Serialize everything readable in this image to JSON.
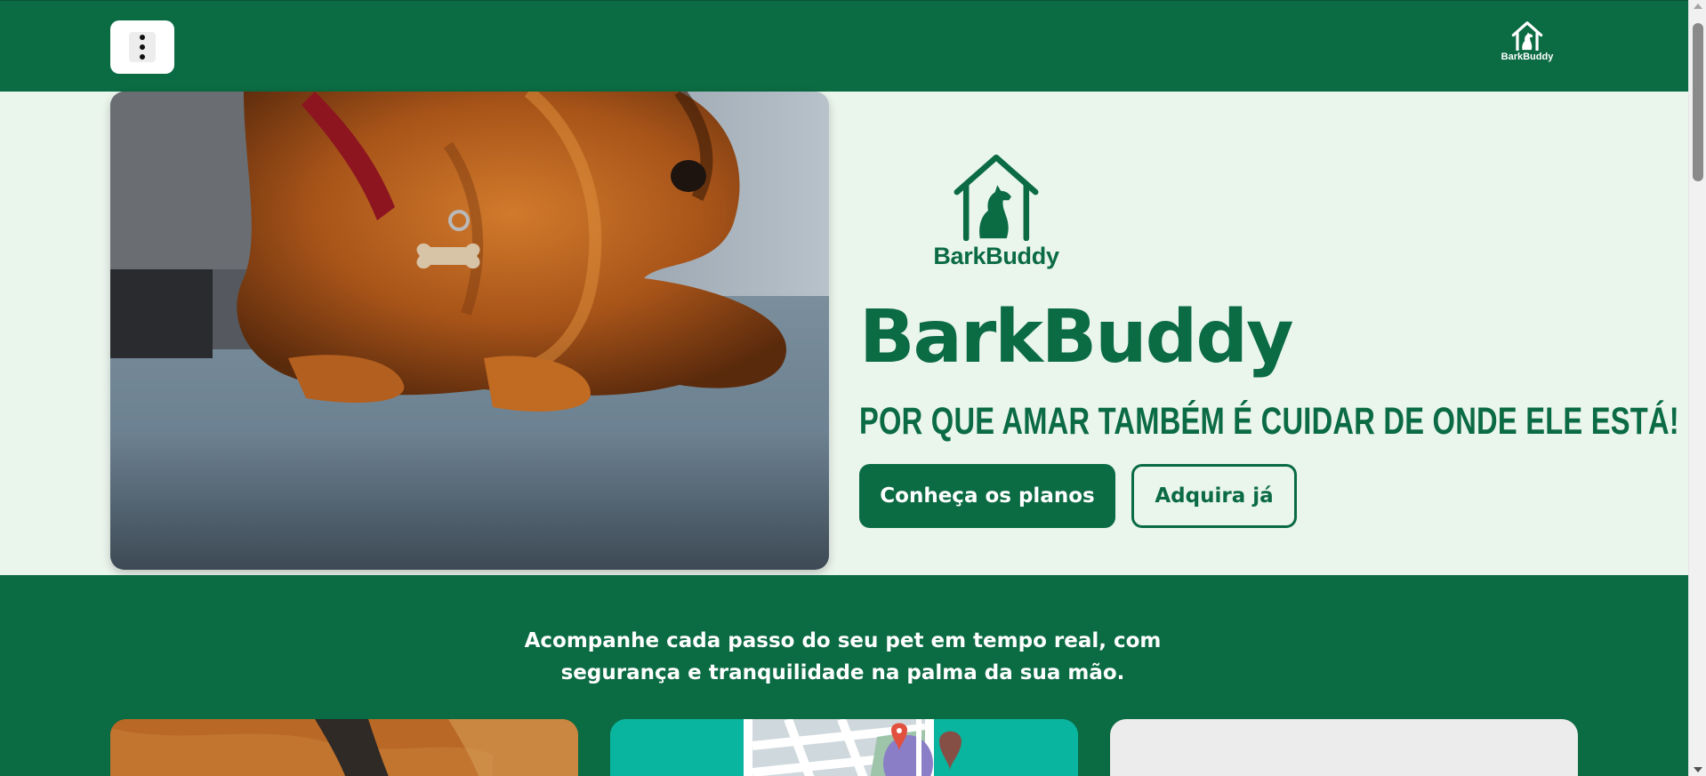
{
  "header": {
    "menu_icon": "more-vertical-icon",
    "logo_text": "BarkBuddy",
    "logo_icon": "dog-house-icon"
  },
  "hero": {
    "image_alt": "cocker-spaniel-lying-on-rug",
    "logo_text": "BarkBuddy",
    "logo_icon": "dog-house-icon",
    "title": "BarkBuddy",
    "tagline": "POR QUE AMAR TAMBÉM É CUIDAR DE ONDE ELE ESTÁ!",
    "primary_button": "Conheça os planos",
    "secondary_button": "Adquira já"
  },
  "features": {
    "intro_text": "Acompanhe cada passo do seu pet em tempo real, com segurança e tranquilidade na palma da sua mão.",
    "cards": [
      {
        "image": "dog-fur-collar-photo"
      },
      {
        "image": "map-location-pin-illustration"
      },
      {
        "image": "placeholder"
      }
    ]
  },
  "colors": {
    "brand_green": "#0b6b43",
    "hero_background": "#eaf5ec",
    "white": "#ffffff",
    "teal_card": "#0ab5a0"
  }
}
